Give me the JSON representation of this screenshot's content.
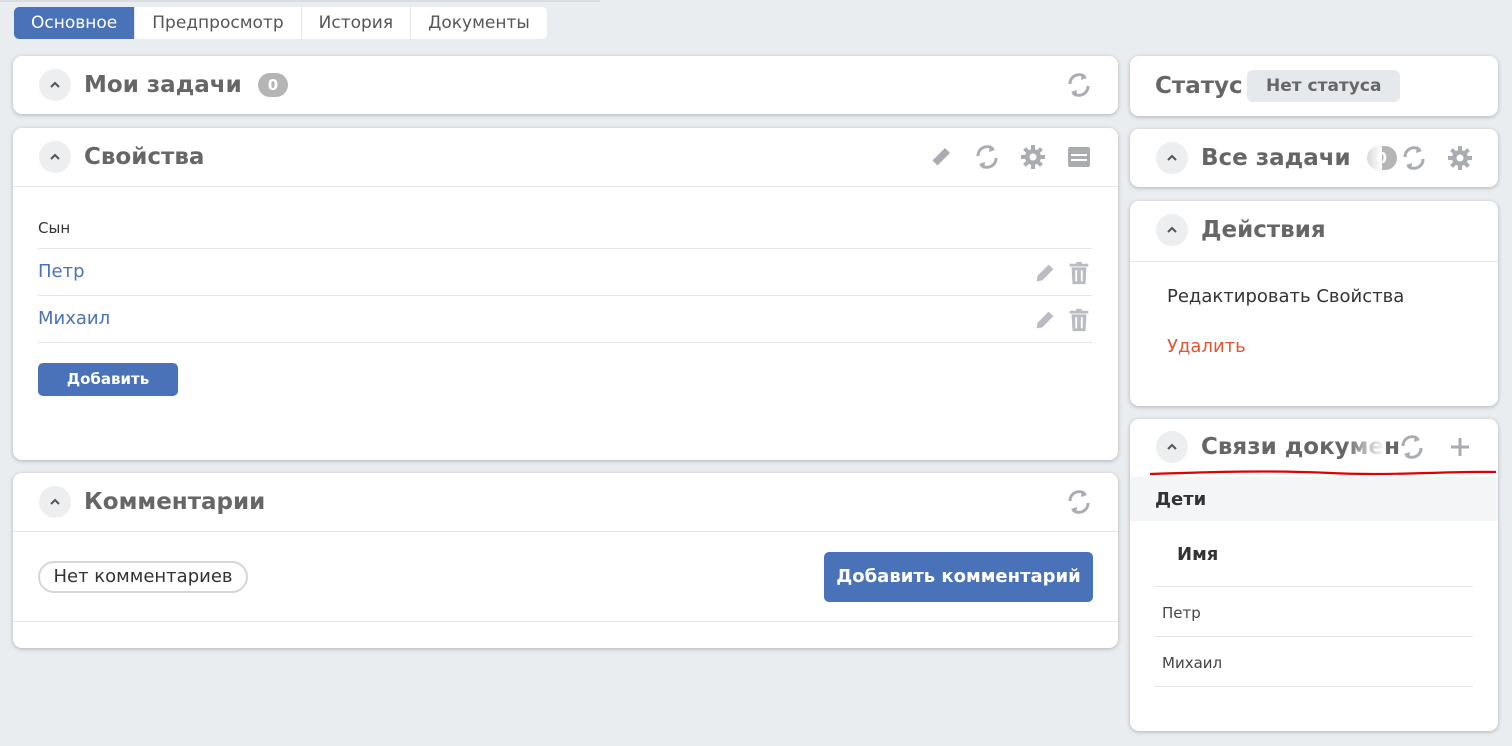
{
  "tabs": [
    "Основное",
    "Предпросмотр",
    "История",
    "Документы"
  ],
  "my_tasks": {
    "title": "Мои задачи",
    "count": "0"
  },
  "properties": {
    "title": "Свойства",
    "label": "Сын",
    "items": [
      "Петр",
      "Михаил"
    ],
    "add_button": "Добавить"
  },
  "comments": {
    "title": "Комментарии",
    "empty": "Нет комментариев",
    "add_button": "Добавить комментарий"
  },
  "status": {
    "label": "Статус",
    "value": "Нет статуса"
  },
  "all_tasks": {
    "title": "Все задачи",
    "count": "0"
  },
  "actions": {
    "title": "Действия",
    "edit": "Редактировать Свойства",
    "delete": "Удалить"
  },
  "links": {
    "title": "Связи докумен",
    "section": "Дети",
    "column": "Имя",
    "rows": [
      "Петр",
      "Михаил"
    ]
  },
  "colors": {
    "accent": "#4a72b8",
    "danger": "#e8532f",
    "icon": "#a9adb1",
    "annotation": "#e00000"
  }
}
